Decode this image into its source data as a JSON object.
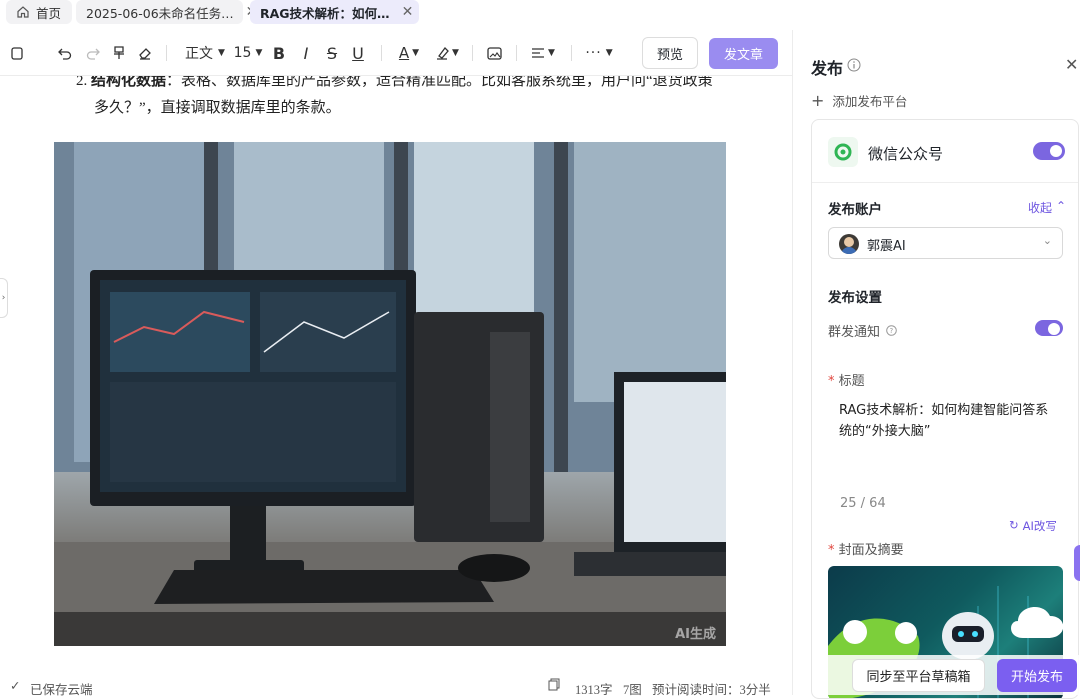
{
  "tabs": [
    {
      "label": "首页",
      "icon": "home-icon"
    },
    {
      "label": "2025-06-06未命名任务…"
    },
    {
      "label": "RAG技术解析：如何…"
    }
  ],
  "toolbar": {
    "para_style": "正文",
    "font_size": "15",
    "preview": "预览",
    "publish": "发文章"
  },
  "editor": {
    "list_number": "2.",
    "bold_term": "结构化数据",
    "text_line1": "：表格、数据库里的产品参数，适合精准匹配。比如客服系统里，用户问“退货政策",
    "text_line2": "多久？”，直接调取数据库里的条款。",
    "image_watermark": "AI生成"
  },
  "footer": {
    "saved": "已保存云端",
    "words": "1313字",
    "images": "7图",
    "read_time": "预计阅读时间：3分半"
  },
  "panel": {
    "title": "发布",
    "add_platform": "添加发布平台",
    "platform_name": "微信公众号",
    "account_label": "发布账户",
    "collapse": "收起",
    "account_name": "郭震AI",
    "settings_label": "发布设置",
    "group_notify": "群发通知",
    "title_label": "标题",
    "title_value": "RAG技术解析：如何构建智能问答系统的“外接大脑”",
    "title_count": "25 / 64",
    "ai_rewrite": "AI改写",
    "cover_label": "封面及摘要",
    "required_mark": "*",
    "sync_draft": "同步至平台草稿箱",
    "start_publish": "开始发布"
  },
  "colors": {
    "accent": "#7b66e0",
    "tab_active_bg": "#ecebfb",
    "publish_btn": "#9a8cf0"
  }
}
